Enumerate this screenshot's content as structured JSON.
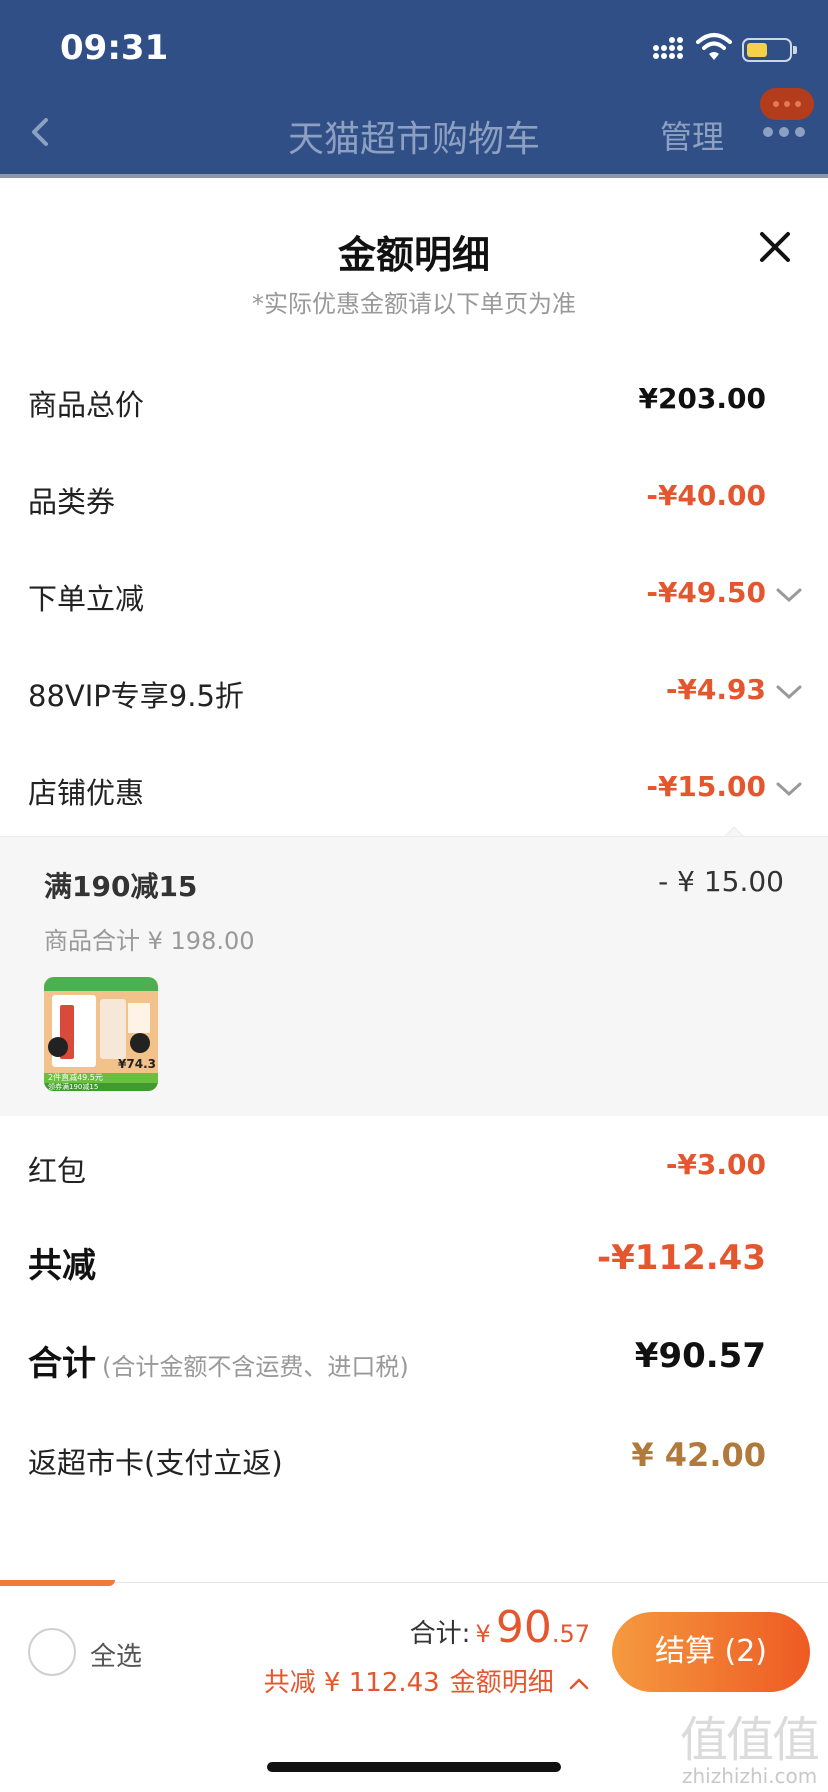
{
  "status_bar": {
    "time": "09:31"
  },
  "nav": {
    "title": "天猫超市购物车",
    "manage": "管理"
  },
  "sheet": {
    "title": "金额明细",
    "subtitle": "*实际优惠金额请以下单页为准",
    "rows": [
      {
        "label": "商品总价",
        "value": "¥203.00"
      },
      {
        "label": "品类券",
        "value": "-¥40.00"
      },
      {
        "label": "下单立减",
        "value": "-¥49.50"
      },
      {
        "label": "88VIP专享9.5折",
        "value": "-¥4.93"
      },
      {
        "label": "店铺优惠",
        "value": "-¥15.00"
      }
    ],
    "shop_discount_detail": {
      "title": "满190减15",
      "amount": "- ¥ 15.00",
      "subtotal": "商品合计 ¥ 198.00",
      "thumb_price": "¥74.3",
      "thumb_promo": "2件直减49.5元",
      "thumb_tag": "领券满190减15"
    },
    "red_packet": {
      "label": "红包",
      "value": "-¥3.00"
    },
    "total_discount": {
      "label": "共减",
      "value": "-¥112.43"
    },
    "total": {
      "label": "合计",
      "note": "(合计金额不含运费、进口税)",
      "value": "¥90.57"
    },
    "cashback": {
      "label": "返超市卡(支付立返)",
      "value": "¥ 42.00"
    }
  },
  "bottom_bar": {
    "select_all": "全选",
    "sum_label": "合计:",
    "currency": "¥",
    "sum_int": "90",
    "sum_dec": ".57",
    "discount_text": "共减 ¥ 112.43",
    "detail_link": "金额明细",
    "checkout": "结算 (2)"
  },
  "watermark": {
    "glyphs": "值值值",
    "url": "zhizhizhi.com"
  },
  "colors": {
    "header_bg": "#2f4f86",
    "accent": "#e4572e",
    "gold": "#b07a3c",
    "checkout_start": "#f59a3f",
    "checkout_end": "#ee5a23"
  }
}
